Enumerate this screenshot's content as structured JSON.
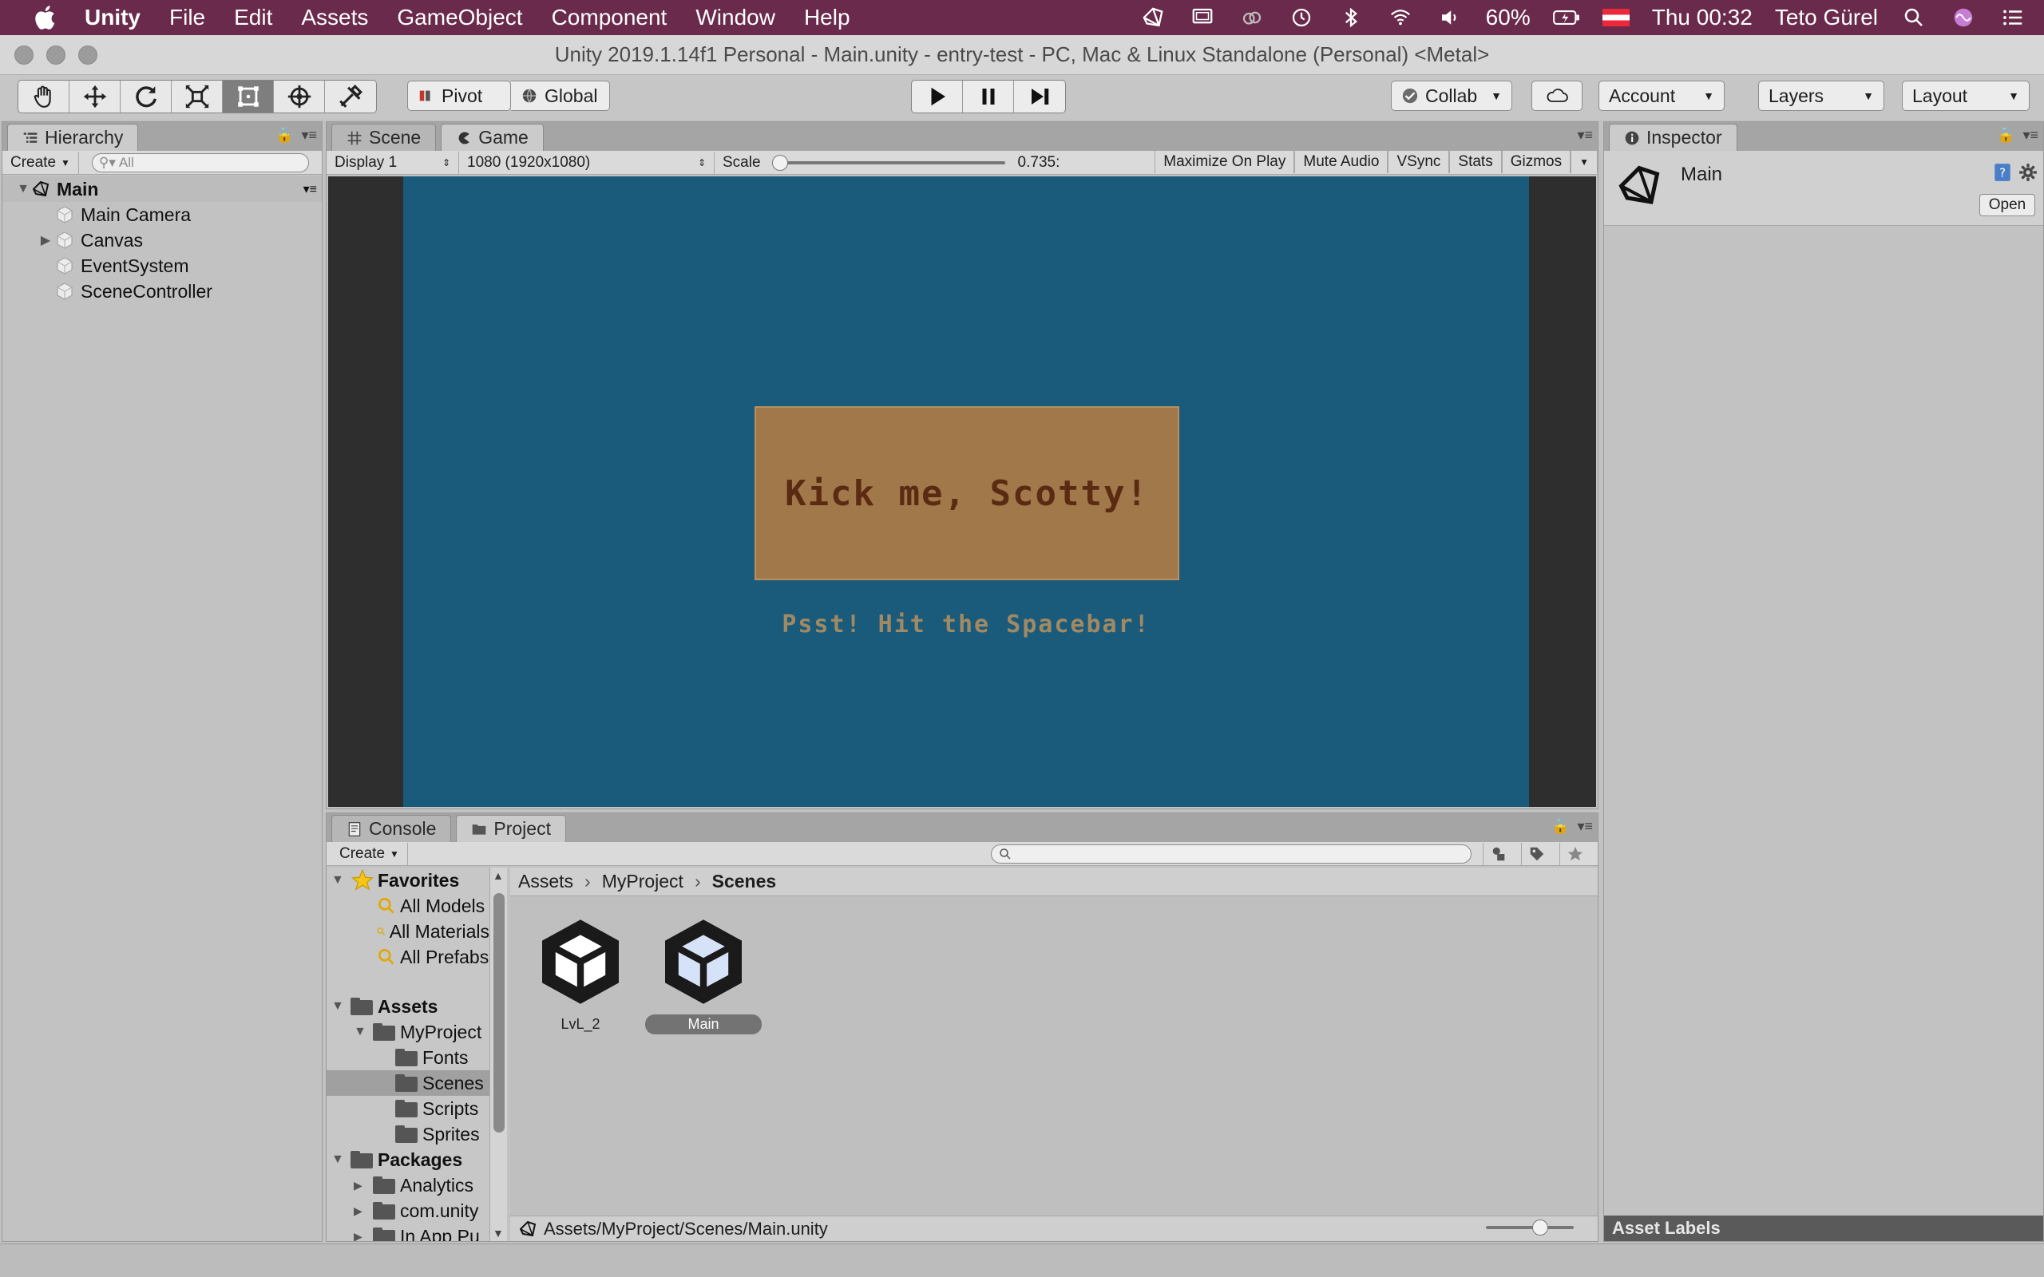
{
  "menubar": {
    "items": [
      "Unity",
      "File",
      "Edit",
      "Assets",
      "GameObject",
      "Component",
      "Window",
      "Help"
    ],
    "battery": "60%",
    "clock": "Thu 00:32",
    "user": "Teto Gürel"
  },
  "window": {
    "title": "Unity 2019.1.14f1 Personal - Main.unity - entry-test - PC, Mac & Linux Standalone (Personal) <Metal>"
  },
  "toolbar": {
    "pivot": "Pivot",
    "global": "Global",
    "collab": "Collab",
    "account": "Account",
    "layers": "Layers",
    "layout": "Layout"
  },
  "hierarchy": {
    "tab": "Hierarchy",
    "create": "Create",
    "search_placeholder": "All",
    "scene": "Main",
    "items": [
      "Main Camera",
      "Canvas",
      "EventSystem",
      "SceneController"
    ]
  },
  "game_view": {
    "tabs": [
      "Scene",
      "Game"
    ],
    "display": "Display 1",
    "resolution": "1080 (1920x1080)",
    "scale_label": "Scale",
    "scale_value": "0.735:",
    "options": [
      "Maximize On Play",
      "Mute Audio",
      "VSync",
      "Stats",
      "Gizmos"
    ],
    "title_text": "Kick me, Scotty!",
    "hint_text": "Psst! Hit the Spacebar!",
    "colors": {
      "background": "#1a5a7a",
      "panel": "#a1784a",
      "title": "#5a2a12",
      "hint": "#a08a64"
    }
  },
  "project": {
    "tabs": [
      "Console",
      "Project"
    ],
    "create": "Create",
    "favorites": {
      "label": "Favorites",
      "items": [
        "All Models",
        "All Materials",
        "All Prefabs"
      ]
    },
    "assets": {
      "label": "Assets",
      "myproject": "MyProject",
      "folders": [
        "Fonts",
        "Scenes",
        "Scripts",
        "Sprites"
      ],
      "selected": "Scenes"
    },
    "packages": {
      "label": "Packages",
      "items": [
        "Analytics",
        "com.unity",
        "In App Pu"
      ]
    },
    "breadcrumb": [
      "Assets",
      "MyProject",
      "Scenes"
    ],
    "scene_assets": [
      "LvL_2",
      "Main"
    ],
    "selected_asset": "Main",
    "path": "Assets/MyProject/Scenes/Main.unity"
  },
  "inspector": {
    "tab": "Inspector",
    "object_name": "Main",
    "open_button": "Open",
    "asset_labels": "Asset Labels"
  }
}
